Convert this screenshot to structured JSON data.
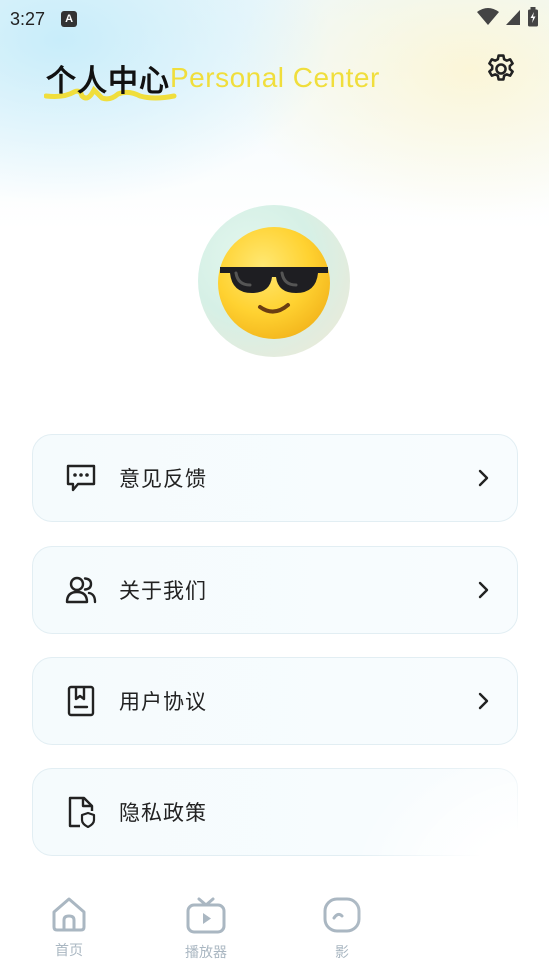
{
  "status_bar": {
    "time": "3:27",
    "notification_icon": "a-notification-icon",
    "icons": [
      "wifi-icon",
      "signal-icon",
      "battery-icon"
    ]
  },
  "header": {
    "title_cn": "个人中心",
    "title_en": "Personal Center",
    "settings_icon": "gear-icon",
    "accent_color": "#f0de3c"
  },
  "avatar": {
    "icon": "cool-emoji-avatar"
  },
  "menu": {
    "items": [
      {
        "label": "意见反馈",
        "icon": "feedback-icon",
        "has_chevron": true
      },
      {
        "label": "关于我们",
        "icon": "users-icon",
        "has_chevron": true
      },
      {
        "label": "用户协议",
        "icon": "agreement-icon",
        "has_chevron": true
      },
      {
        "label": "隐私政策",
        "icon": "privacy-icon",
        "has_chevron": false
      }
    ]
  },
  "tabbar": {
    "items": [
      {
        "label": "首页",
        "icon": "home-icon"
      },
      {
        "label": "播放器",
        "icon": "tv-play-icon"
      },
      {
        "label": "影",
        "icon": "film-icon"
      }
    ],
    "inactive_color": "#aab7c2"
  }
}
